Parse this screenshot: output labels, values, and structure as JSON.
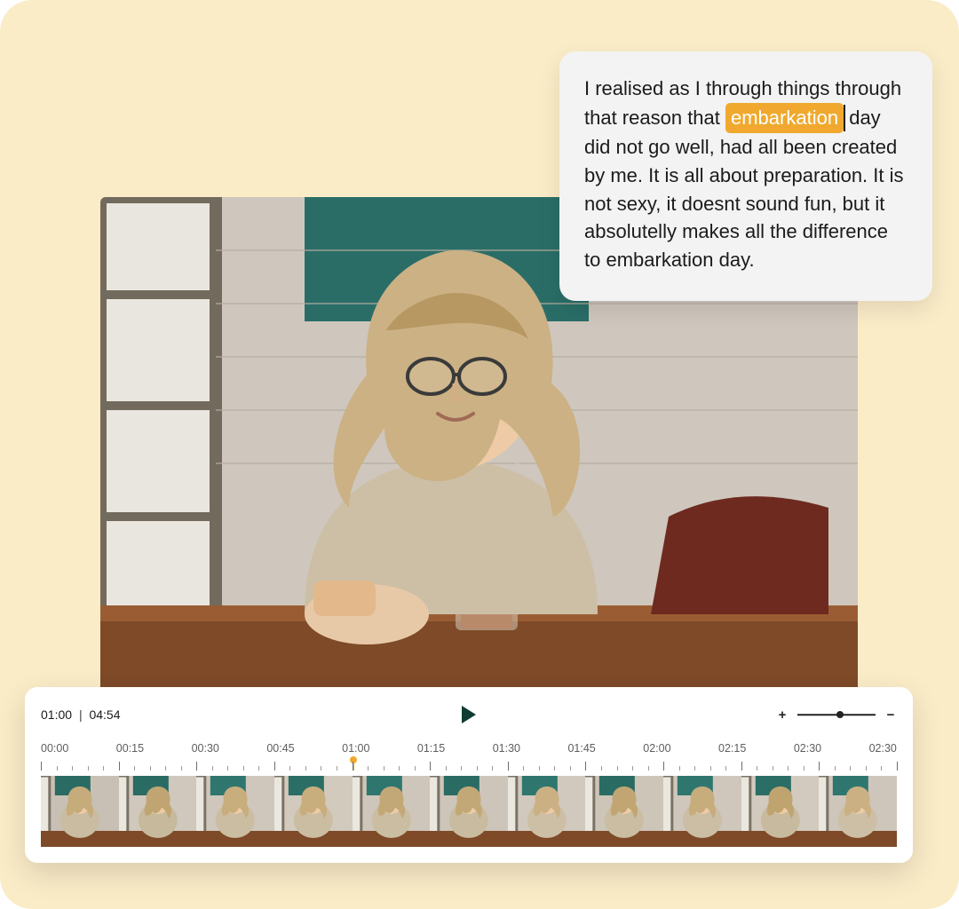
{
  "transcript": {
    "pre": "I realised as I through things through that reason that ",
    "highlight": "embarkation",
    "post": " day did not go well, had all been created by me. It is all about preparation. It is not sexy, it doesnt sound fun, but it absolutelly makes all the difference to embarkation day."
  },
  "player": {
    "current": "01:00",
    "duration": "04:54",
    "zoom_in": "+",
    "zoom_out": "−",
    "zoom_value_pct": 55
  },
  "ruler": {
    "labels": [
      "00:00",
      "00:15",
      "00:30",
      "00:45",
      "01:00",
      "01:15",
      "01:30",
      "01:45",
      "02:00",
      "02:15",
      "02:30",
      "02:30"
    ],
    "playhead_pct": 36.4
  },
  "colors": {
    "accent": "#f0a92e",
    "panel": "#ffffff",
    "canvas": "#fbecc8"
  }
}
